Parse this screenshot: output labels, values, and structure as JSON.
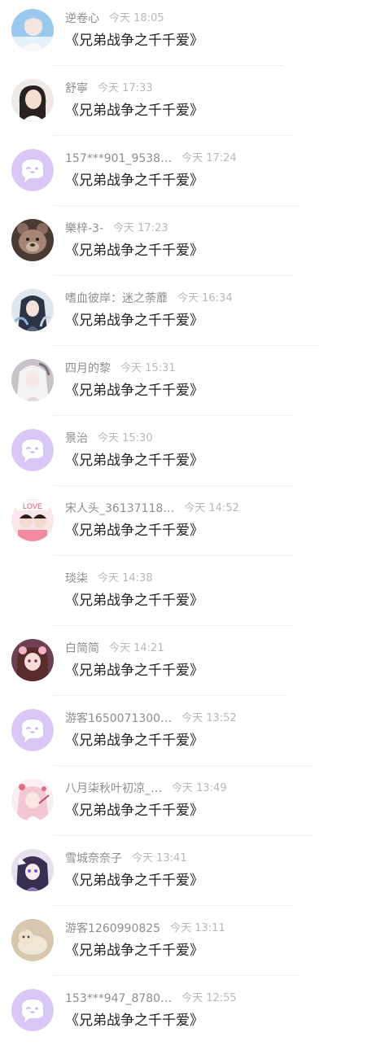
{
  "colors": {
    "name": "#8e8e8e",
    "time": "#b8b8b8",
    "content": "#222222",
    "default_avatar_bg": "#d9c8f5"
  },
  "comments": [
    {
      "name": "逆卷心",
      "time": "今天 18:05",
      "content": "《兄弟战争之千千爱》",
      "avatar": "photo-avatar-sky-boy"
    },
    {
      "name": "舒寧",
      "time": "今天 17:33",
      "content": "《兄弟战争之千千爱》",
      "avatar": "photo-avatar-girl"
    },
    {
      "name": "157***901_9538…",
      "time": "今天 17:24",
      "content": "《兄弟战争之千千爱》",
      "avatar": "default-chat-bubble-icon"
    },
    {
      "name": "樂梓-3-",
      "time": "今天 17:23",
      "content": "《兄弟战争之千千爱》",
      "avatar": "photo-avatar-bear"
    },
    {
      "name": "嗜血彼岸：迷之荼蘼",
      "time": "今天 16:34",
      "content": "《兄弟战争之千千爱》",
      "avatar": "photo-avatar-anime-girl"
    },
    {
      "name": "四月的黎",
      "time": "今天 15:31",
      "content": "《兄弟战争之千千爱》",
      "avatar": "photo-avatar-white-hair"
    },
    {
      "name": "景治",
      "time": "今天 15:30",
      "content": "《兄弟战争之千千爱》",
      "avatar": "default-chat-bubble-icon"
    },
    {
      "name": "宋人头_36137118…",
      "time": "今天 14:52",
      "content": "《兄弟战争之千千爱》",
      "avatar": "photo-avatar-love-couple"
    },
    {
      "name": "琰柒",
      "time": "今天 14:38",
      "content": "《兄弟战争之千千爱》",
      "avatar": "none"
    },
    {
      "name": "白简简",
      "time": "今天 14:21",
      "content": "《兄弟战争之千千爱》",
      "avatar": "photo-avatar-anime-brown"
    },
    {
      "name": "游客1650071300…",
      "time": "今天 13:52",
      "content": "《兄弟战争之千千爱》",
      "avatar": "default-chat-bubble-icon"
    },
    {
      "name": "八月柒秋叶初凉_…",
      "time": "今天 13:49",
      "content": "《兄弟战争之千千爱》",
      "avatar": "photo-avatar-pink-anime"
    },
    {
      "name": "雪城奈奈子",
      "time": "今天 13:41",
      "content": "《兄弟战争之千千爱》",
      "avatar": "photo-avatar-anime-purple"
    },
    {
      "name": "游客1260990825",
      "time": "今天 13:11",
      "content": "《兄弟战争之千千爱》",
      "avatar": "photo-avatar-cat"
    },
    {
      "name": "153***947_8780…",
      "time": "今天 12:55",
      "content": "《兄弟战争之千千爱》",
      "avatar": "default-chat-bubble-icon"
    }
  ]
}
